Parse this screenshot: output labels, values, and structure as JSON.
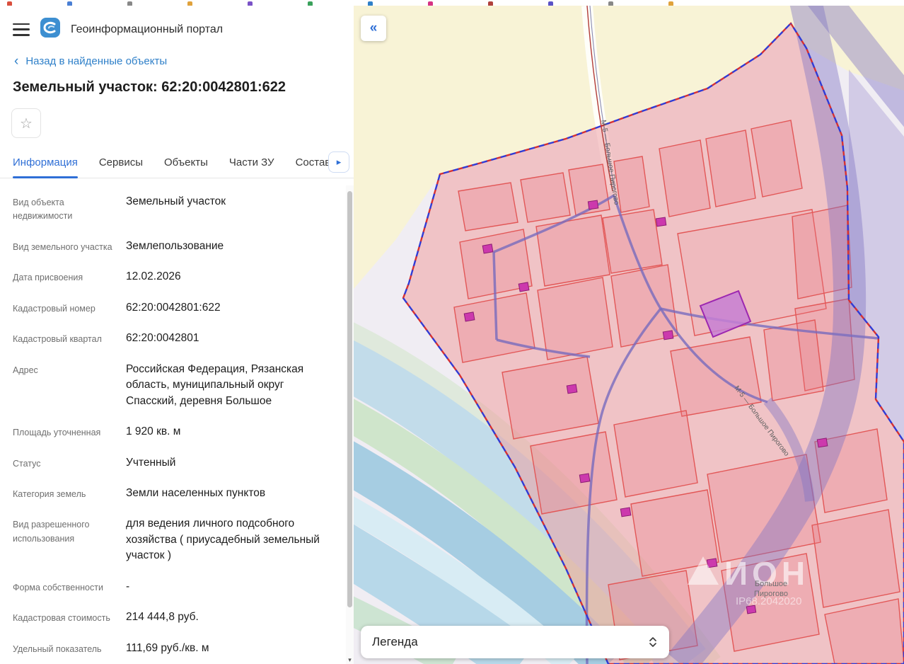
{
  "app": {
    "title": "Геоинформационный портал"
  },
  "icons": {
    "star": "☆",
    "back_chevron": "‹",
    "collapse": "«",
    "tab_next": "▸",
    "scroll_down": "▾"
  },
  "back_link": "Назад в найденные объекты",
  "page_title": "Земельный участок: 62:20:0042801:622",
  "tabs": [
    {
      "label": "Информация",
      "active": true
    },
    {
      "label": "Сервисы",
      "active": false
    },
    {
      "label": "Объекты",
      "active": false
    },
    {
      "label": "Части ЗУ",
      "active": false
    },
    {
      "label": "Состав",
      "active": false
    }
  ],
  "info_rows": [
    {
      "label": "Вид объекта недвижимости",
      "value": "Земельный участок"
    },
    {
      "label": "Вид земельного участка",
      "value": "Землепользование"
    },
    {
      "label": "Дата присвоения",
      "value": "12.02.2026"
    },
    {
      "label": "Кадастровый номер",
      "value": "62:20:0042801:622"
    },
    {
      "label": "Кадастровый квартал",
      "value": "62:20:0042801"
    },
    {
      "label": "Адрес",
      "value": "Российская Федерация, Рязанская область, муниципальный округ Спасский, деревня Большое"
    },
    {
      "label": "Площадь уточненная",
      "value": "1 920 кв. м"
    },
    {
      "label": "Статус",
      "value": "Учтенный"
    },
    {
      "label": "Категория земель",
      "value": "Земли населенных пунктов"
    },
    {
      "label": "Вид разрешенного использования",
      "value": "для ведения личного подсобного хозяйства ( приусадебный земельный участок )"
    },
    {
      "label": "Форма собственности",
      "value": "-"
    },
    {
      "label": "Кадастровая стоимость",
      "value": "214 444,8 руб."
    },
    {
      "label": "Удельный показатель",
      "value": "111,69 руб./кв. м"
    }
  ],
  "map": {
    "legend_label": "Легенда",
    "road_label": "М-5 — Большое Пирогово",
    "village_label_line1": "Большое",
    "village_label_line2": "Пирогово",
    "watermark_line1": "ИОН",
    "watermark_line2": "IP68.2042020"
  },
  "colors": {
    "accent_blue": "#2f6fd6",
    "link_blue": "#2f80c9",
    "parcel_stroke": "#e05b5b",
    "quarter_fill": "#ef9a9a",
    "selected_parcel": "#9c27b0",
    "building_marker": "#cc39ad",
    "boundary_red": "#d63031",
    "boundary_blue": "#2f3bd6"
  }
}
